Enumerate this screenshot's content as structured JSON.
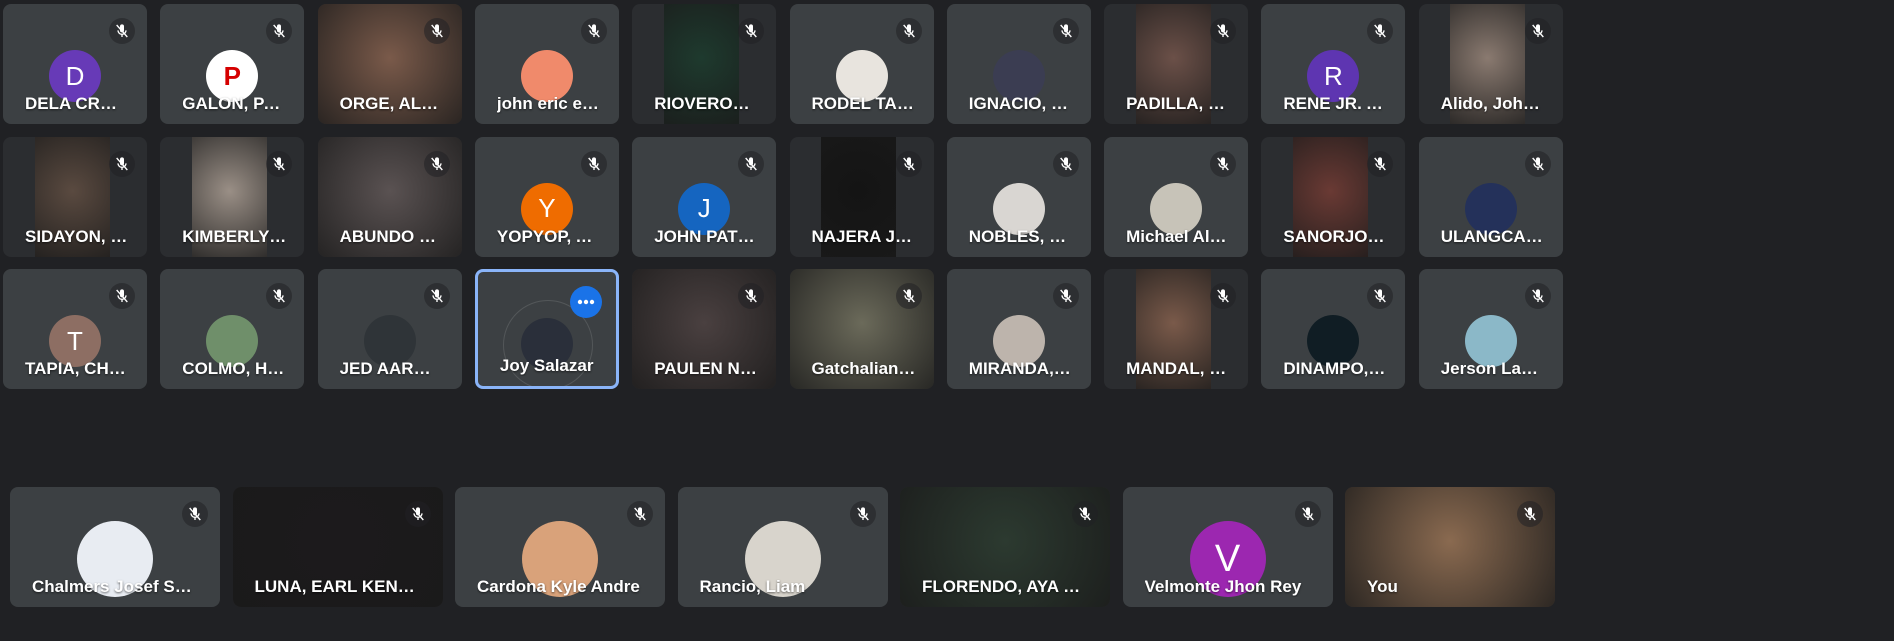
{
  "participants": [
    {
      "name": "DELA CRUZ G...",
      "tile": "avatar",
      "letter": "D",
      "color": "#673ab7"
    },
    {
      "name": "GALON, PAUL ...",
      "tile": "avatar",
      "letter": "P",
      "color": "#ffffff",
      "fg": "#d50000"
    },
    {
      "name": "ORGE, ALEXA...",
      "tile": "video",
      "color": "#7a5a4a"
    },
    {
      "name": "john eric elica...",
      "tile": "avatar",
      "letter": "",
      "color": "#f08a6b"
    },
    {
      "name": "RIOVEROS, HE...",
      "tile": "video",
      "color": "#1e3a2e"
    },
    {
      "name": "RODEL TABAY...",
      "tile": "avatar",
      "letter": "",
      "color": "#e8e4de"
    },
    {
      "name": "IGNACIO, DIA...",
      "tile": "avatar",
      "letter": "",
      "color": "#3b3d52"
    },
    {
      "name": "PADILLA, JHO...",
      "tile": "video",
      "color": "#6b5048"
    },
    {
      "name": "RENE JR. APR...",
      "tile": "avatar",
      "letter": "R",
      "color": "#5e35b1"
    },
    {
      "name": "Alido, John He...",
      "tile": "video",
      "color": "#8a7a70"
    },
    {
      "name": "SIDAYON, JO...",
      "tile": "video",
      "color": "#5a4a40"
    },
    {
      "name": "KIMBERLY BA...",
      "tile": "video",
      "color": "#9a8f86"
    },
    {
      "name": "ABUNDO CHA...",
      "tile": "video",
      "color": "#5a5252"
    },
    {
      "name": "YOPYOP, AIM...",
      "tile": "avatar",
      "letter": "Y",
      "color": "#ef6c00"
    },
    {
      "name": "JOHN PATRIC...",
      "tile": "avatar",
      "letter": "J",
      "color": "#1565c0"
    },
    {
      "name": "NAJERA JOH...",
      "tile": "video",
      "color": "#141414"
    },
    {
      "name": "NOBLES, ZAKI ...",
      "tile": "avatar",
      "letter": "",
      "color": "#d9d6d2"
    },
    {
      "name": "Michael Alvin ...",
      "tile": "avatar",
      "letter": "",
      "color": "#c7c3b8"
    },
    {
      "name": "SANORJO, JA...",
      "tile": "video",
      "color": "#6a3a34"
    },
    {
      "name": "ULANGCA, JO...",
      "tile": "avatar",
      "letter": "",
      "color": "#24315a"
    },
    {
      "name": "TAPIA, CHRIST...",
      "tile": "avatar",
      "letter": "T",
      "color": "#8d6e63"
    },
    {
      "name": "COLMO, HAN...",
      "tile": "avatar",
      "letter": "",
      "color": "#6f8f6a"
    },
    {
      "name": "JED AARON S...",
      "tile": "avatar",
      "letter": "",
      "color": "#2f3438"
    },
    {
      "name": "Joy Salazar",
      "tile": "avatar",
      "letter": "",
      "color": "#2a2f3a",
      "active": true
    },
    {
      "name": "PAULEN NICO...",
      "tile": "video",
      "color": "#4a4040"
    },
    {
      "name": "Gatchalian Ru...",
      "tile": "video",
      "color": "#6b6a5a"
    },
    {
      "name": "MIRANDA, DIV...",
      "tile": "avatar",
      "letter": "",
      "color": "#bdb4ac"
    },
    {
      "name": "MANDAL, RAL...",
      "tile": "video",
      "color": "#7a5a4a"
    },
    {
      "name": "DINAMPO, PRI...",
      "tile": "avatar",
      "letter": "",
      "color": "#101d24"
    },
    {
      "name": "Jerson Lapno",
      "tile": "avatar",
      "letter": "",
      "color": "#8bb8c8"
    },
    {
      "name": "Chalmers Josef Soriano",
      "tile": "avatar",
      "letter": "",
      "color": "#e8ecf2"
    },
    {
      "name": "LUNA, EARL KENNETH",
      "tile": "video",
      "color": "#1c1a1c"
    },
    {
      "name": "Cardona Kyle Andre",
      "tile": "avatar",
      "letter": "",
      "color": "#d9a27a"
    },
    {
      "name": "Rancio, Liam",
      "tile": "avatar",
      "letter": "",
      "color": "#d8d4cc"
    },
    {
      "name": "FLORENDO, AYA MIKHA...",
      "tile": "video",
      "color": "#2c3a30"
    },
    {
      "name": "Velmonte Jhon Rey",
      "tile": "avatar",
      "letter": "V",
      "color": "#9c27b0"
    },
    {
      "name": "You",
      "tile": "video",
      "color": "#8a6a50"
    }
  ],
  "icons": {
    "mute": "mic-off-icon",
    "more": "more-options-icon"
  }
}
